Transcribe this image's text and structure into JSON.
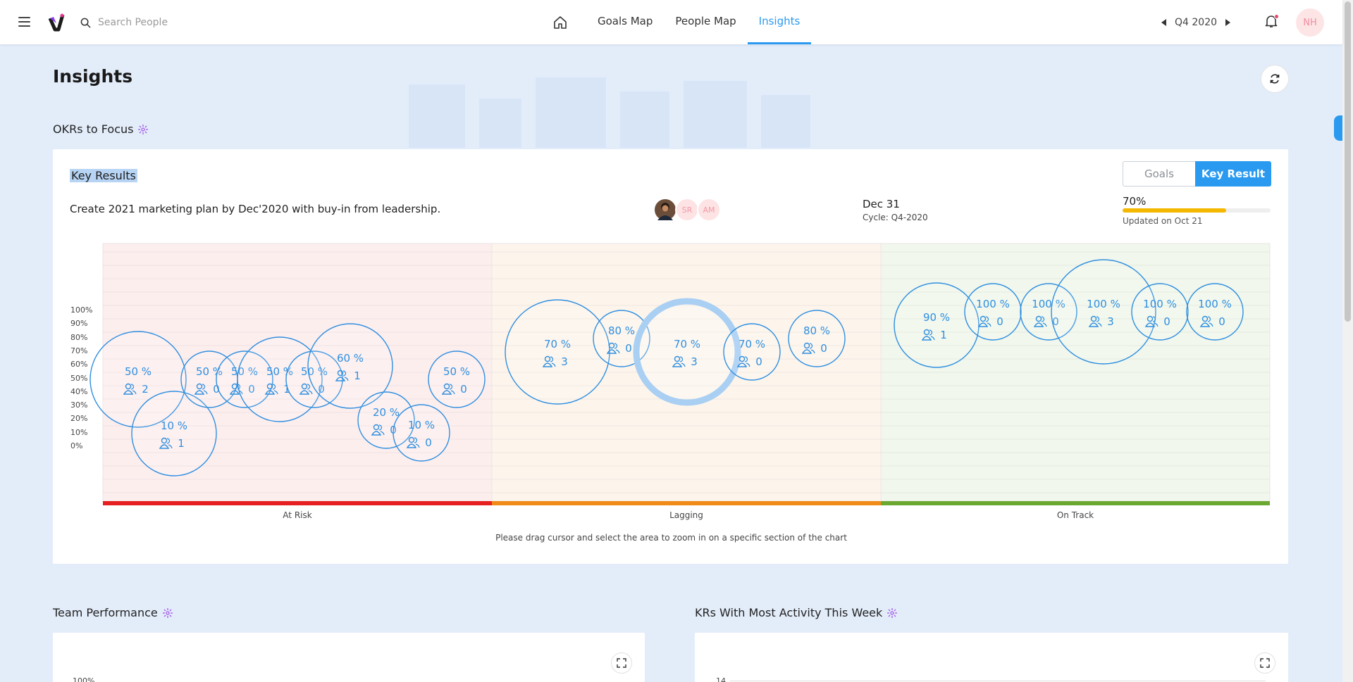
{
  "topbar": {
    "search_placeholder": "Search People",
    "tabs": [
      {
        "label": "Goals Map",
        "active": false
      },
      {
        "label": "People Map",
        "active": false
      },
      {
        "label": "Insights",
        "active": true
      }
    ],
    "quarter": "Q4 2020",
    "user_initials": "NH",
    "accent_color": "#2a9af0"
  },
  "page": {
    "title": "Insights"
  },
  "okr_section": {
    "title": "OKRs to Focus",
    "heading": "Key Results",
    "toggle": {
      "goals": "Goals",
      "key_result": "Key Result",
      "selected": "Key Result"
    },
    "kr": {
      "text": "Create 2021 marketing plan by Dec'2020 with buy-in from leadership.",
      "owners": [
        {
          "type": "photo"
        },
        {
          "initials": "SR"
        },
        {
          "initials": "AM"
        }
      ],
      "due": "Dec 31",
      "cycle": "Cycle: Q4-2020",
      "progress_label": "70%",
      "progress": 0.7,
      "updated": "Updated on Oct 21"
    },
    "zoom_hint": "Please drag cursor and select the area to zoom in on a specific section of the chart"
  },
  "chart_data": {
    "type": "scatter",
    "y_ticks": [
      "100%",
      "90%",
      "80%",
      "70%",
      "60%",
      "50%",
      "40%",
      "30%",
      "20%",
      "10%",
      "0%"
    ],
    "zones": [
      {
        "name": "At Risk",
        "color": "#e62020",
        "bg": "#fdeeee"
      },
      {
        "name": "Lagging",
        "color": "#f08a18",
        "bg": "#fdf5ec"
      },
      {
        "name": "On Track",
        "color": "#6aa832",
        "bg": "#f1f7ec"
      }
    ],
    "points": [
      {
        "zone": "At Risk",
        "label": "50 %",
        "people": "2"
      },
      {
        "zone": "At Risk",
        "label": "10 %",
        "people": "1"
      },
      {
        "zone": "At Risk",
        "label": "50 %",
        "people": "0"
      },
      {
        "zone": "At Risk",
        "label": "50 %",
        "people": "0"
      },
      {
        "zone": "At Risk",
        "label": "50 %",
        "people": "1"
      },
      {
        "zone": "At Risk",
        "label": "50 %",
        "people": "0"
      },
      {
        "zone": "At Risk",
        "label": "60 %",
        "people": "1"
      },
      {
        "zone": "At Risk",
        "label": "20 %",
        "people": "0"
      },
      {
        "zone": "At Risk",
        "label": "10 %",
        "people": "0"
      },
      {
        "zone": "At Risk",
        "label": "50 %",
        "people": "0"
      },
      {
        "zone": "Lagging",
        "label": "70 %",
        "people": "3"
      },
      {
        "zone": "Lagging",
        "label": "80 %",
        "people": "0"
      },
      {
        "zone": "Lagging",
        "label": "70 %",
        "people": "3",
        "selected": true
      },
      {
        "zone": "Lagging",
        "label": "70 %",
        "people": "0"
      },
      {
        "zone": "Lagging",
        "label": "80 %",
        "people": "0"
      },
      {
        "zone": "On Track",
        "label": "90 %",
        "people": "1"
      },
      {
        "zone": "On Track",
        "label": "100 %",
        "people": "0"
      },
      {
        "zone": "On Track",
        "label": "100 %",
        "people": "0"
      },
      {
        "zone": "On Track",
        "label": "100 %",
        "people": "3"
      },
      {
        "zone": "On Track",
        "label": "100 %",
        "people": "0"
      },
      {
        "zone": "On Track",
        "label": "100 %",
        "people": "0"
      }
    ]
  },
  "team_performance": {
    "title": "Team Performance",
    "first_tick": "100%"
  },
  "kr_activity": {
    "title": "KRs With Most Activity This Week",
    "first_tick": "14"
  }
}
